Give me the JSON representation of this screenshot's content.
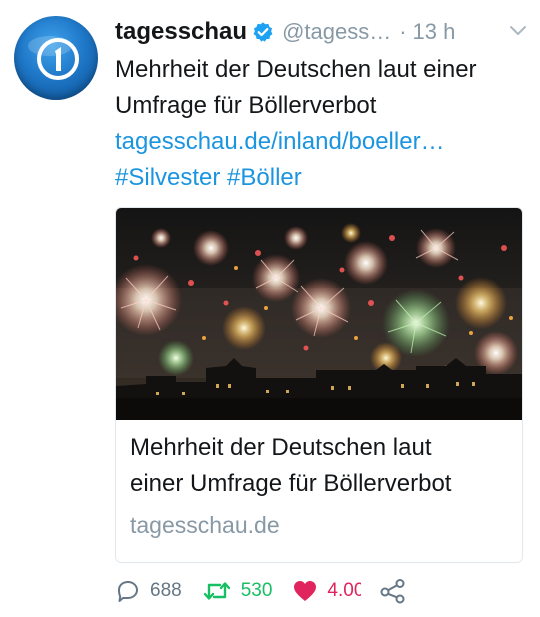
{
  "tweet": {
    "author_name": "tagesschau",
    "handle": "@tagess…",
    "separator": "·",
    "time": "13 h",
    "text_lines": [
      "Mehrheit der Deutschen laut einer",
      "Umfrage für Böllerverbot"
    ],
    "link": "tagesschau.de/inland/boeller…",
    "hashtags": [
      "#Silvester",
      "#Böller"
    ]
  },
  "card": {
    "title_lines": [
      "Mehrheit der Deutschen laut",
      "einer Umfrage für Böllerverbot"
    ],
    "domain": "tagesschau.de"
  },
  "actions": {
    "replies": "688",
    "retweets": "530",
    "likes": "4.000"
  },
  "colors": {
    "link": "#1b95e0",
    "retweet": "#17bf63",
    "like": "#e0245e",
    "muted": "#8899a6",
    "verified": "#1da1f2"
  },
  "icons": {
    "avatar": "tagesschau-logo",
    "verified": "verified-badge-icon",
    "chevron": "chevron-down-icon",
    "reply": "reply-icon",
    "retweet": "retweet-icon",
    "like": "heart-icon",
    "share": "share-icon"
  }
}
